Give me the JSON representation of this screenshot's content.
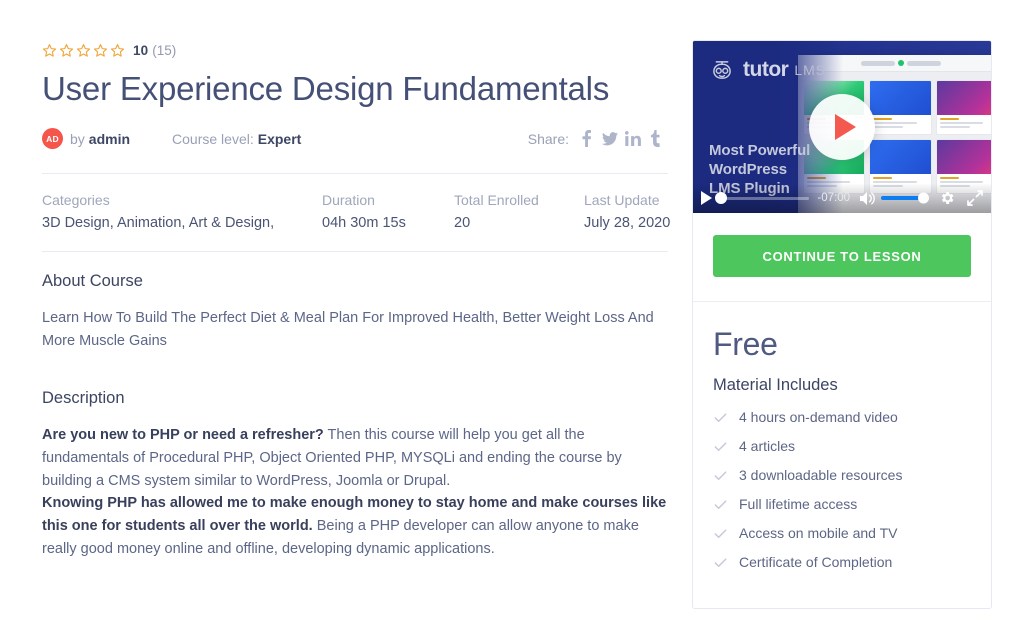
{
  "course": {
    "rating_value": "10",
    "rating_count": "(15)",
    "star_count": 5,
    "title": "User Experience Design Fundamentals",
    "author_initials": "AD",
    "by_text": "by",
    "author_name": "admin",
    "level_label": "Course level:",
    "level_value": "Expert",
    "share_label": "Share:",
    "share_icons": [
      "facebook-icon",
      "twitter-icon",
      "linkedin-icon",
      "tumblr-icon"
    ]
  },
  "stats": [
    {
      "label": "Categories",
      "value": "3D Design, Animation, Art & Design,"
    },
    {
      "label": "Duration",
      "value": "04h 30m 15s"
    },
    {
      "label": "Total Enrolled",
      "value": "20"
    },
    {
      "label": "Last Update",
      "value": "July 28, 2020"
    }
  ],
  "about": {
    "title": "About Course",
    "body": "Learn How To Build The Perfect Diet & Meal Plan For Improved Health, Better Weight Loss And More Muscle Gains"
  },
  "description": {
    "title": "Description",
    "para1_bold": "Are you new to PHP or need a refresher?",
    "para1_rest": " Then this course will help you get all the fundamentals of Procedural PHP, Object Oriented PHP, MYSQLi and ending the course by building a CMS system similar to WordPress, Joomla or Drupal.",
    "para2_bold": "Knowing PHP has allowed me to make enough money to stay home and make courses like this one for students all over the world.",
    "para2_rest": " Being a PHP developer can allow anyone to make really good money online and offline, developing dynamic applications."
  },
  "video": {
    "brand_word": "tutor",
    "brand_suffix": "LMS",
    "tagline_line1": "Most Powerful",
    "tagline_line2": "WordPress",
    "tagline_line3": "LMS Plugin",
    "time_remaining": "-07:00",
    "play_label": "play-button"
  },
  "sidebar": {
    "continue_label": "CONTINUE TO LESSON",
    "price": "Free",
    "material_title": "Material Includes",
    "material_items": [
      "4 hours on-demand video",
      "4 articles",
      "3 downloadable resources",
      "Full lifetime access",
      "Access on mobile and TV",
      "Certificate of Completion"
    ]
  },
  "colors": {
    "accent_green": "#4dc65d",
    "accent_red": "#f4594f",
    "star_gold": "#f0a63a",
    "video_blue": "#1c2b80",
    "text_dark": "#3c4563",
    "text_muted": "#9aa0b6"
  }
}
